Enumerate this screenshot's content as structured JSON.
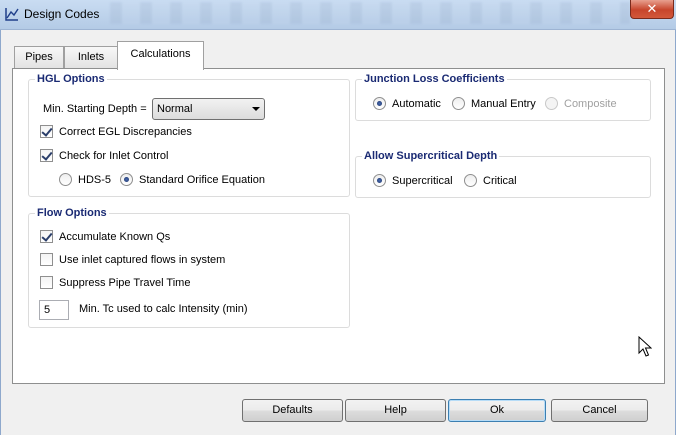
{
  "window": {
    "title": "Design Codes",
    "close_glyph": "✕"
  },
  "tabs": [
    {
      "label": "Pipes"
    },
    {
      "label": "Inlets"
    },
    {
      "label": "Calculations",
      "active": true
    }
  ],
  "hgl_options": {
    "title": "HGL Options",
    "min_starting_depth_label": "Min. Starting Depth =",
    "min_starting_depth_value": "Normal",
    "correct_egl": {
      "label": "Correct EGL Discrepancies",
      "checked": true
    },
    "check_inlet_control": {
      "label": "Check for Inlet Control",
      "checked": true
    },
    "inlet_methods": [
      {
        "label": "HDS-5",
        "selected": false
      },
      {
        "label": "Standard Orifice Equation",
        "selected": true
      }
    ]
  },
  "flow_options": {
    "title": "Flow Options",
    "accumulate_known_qs": {
      "label": "Accumulate Known Qs",
      "checked": true
    },
    "use_inlet_captured": {
      "label": "Use inlet captured flows in system",
      "checked": false
    },
    "suppress_pipe_travel": {
      "label": "Suppress Pipe Travel Time",
      "checked": false
    },
    "min_tc": {
      "value": "5",
      "label": "Min. Tc used to calc Intensity (min)"
    }
  },
  "junction_loss": {
    "title": "Junction Loss Coefficients",
    "options": [
      {
        "label": "Automatic",
        "selected": true,
        "enabled": true
      },
      {
        "label": "Manual Entry",
        "selected": false,
        "enabled": true
      },
      {
        "label": "Composite",
        "selected": false,
        "enabled": false
      }
    ]
  },
  "supercritical": {
    "title": "Allow Supercritical Depth",
    "options": [
      {
        "label": "Supercritical",
        "selected": true
      },
      {
        "label": "Critical",
        "selected": false
      }
    ]
  },
  "buttons": {
    "defaults": "Defaults",
    "help": "Help",
    "ok": "Ok",
    "cancel": "Cancel"
  },
  "colors": {
    "group_title": "#1a2a73",
    "close_button": "#c7452c",
    "default_button_border": "#3c7fb1"
  },
  "icons": {
    "app": "chart-icon",
    "cursor": "mouse-pointer-icon"
  }
}
